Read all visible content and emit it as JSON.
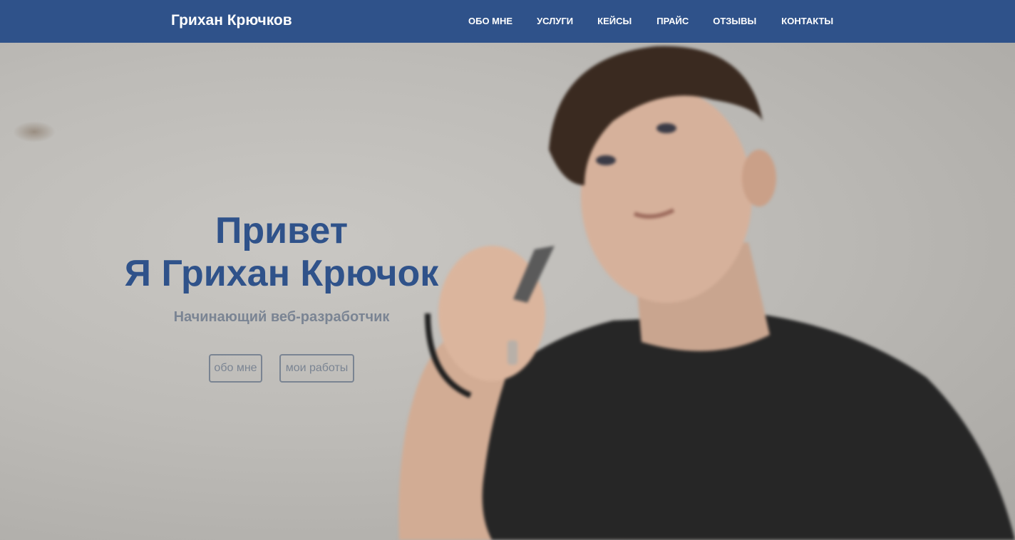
{
  "header": {
    "brand": "Грихан Крючков",
    "nav": [
      {
        "label": "ОБО МНЕ"
      },
      {
        "label": "УСЛУГИ"
      },
      {
        "label": "КЕЙСЫ"
      },
      {
        "label": "ПРАЙС"
      },
      {
        "label": "ОТЗЫВЫ"
      },
      {
        "label": "КОНТАКТЫ"
      }
    ]
  },
  "hero": {
    "title_line1": "Привет",
    "title_line2": "Я Грихан Крючок",
    "subtitle": "Начинающий веб-разработчик",
    "button_about": "обо мне",
    "button_works": "мои работы"
  },
  "colors": {
    "brand_blue": "#2f528a",
    "header_text": "#ffffff",
    "muted_gray": "#6e7a8c"
  }
}
